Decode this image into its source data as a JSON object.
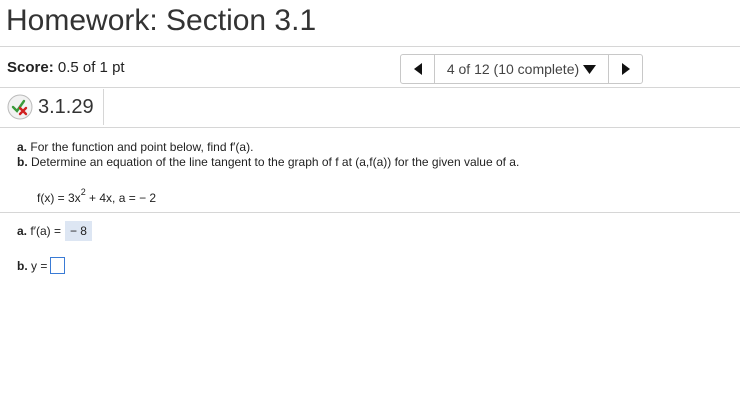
{
  "header": {
    "title": "Homework: Section 3.1"
  },
  "score": {
    "label": "Score:",
    "value": "0.5 of 1 pt"
  },
  "nav": {
    "position": "4 of 12 (10 complete)"
  },
  "question": {
    "number": "3.1.29",
    "status_icon": "partial-incorrect-icon"
  },
  "prompt": {
    "a_label": "a.",
    "a_text": "For the function and point below, find f′(a).",
    "b_label": "b.",
    "b_text": "Determine an equation of the line tangent to the graph of f at (a,f(a)) for the given value of a."
  },
  "function": {
    "lhs": "f(x) = 3x",
    "exponent": "2",
    "rest": " + 4x, a = − 2"
  },
  "answers": {
    "a_label": "a.",
    "a_expr": "f′(a) =",
    "a_value": "− 8",
    "b_label": "b.",
    "b_expr": "y ="
  },
  "colors": {
    "input_border": "#3a7bd5",
    "answer_highlight": "#dde6f3"
  }
}
